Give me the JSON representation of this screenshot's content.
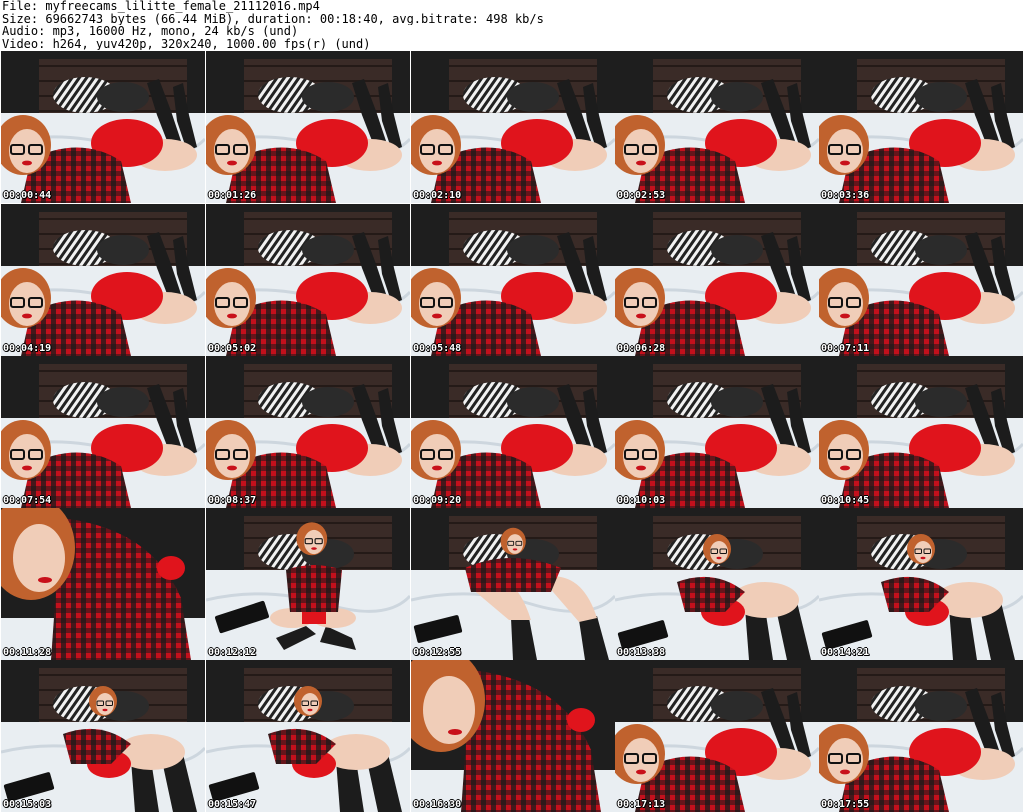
{
  "header": {
    "file": "File: myfreecams_lilitte_female_21112016.mp4",
    "size": "Size: 69662743 bytes (66.44 MiB), duration: 00:18:40, avg.bitrate: 498 kb/s",
    "audio": "Audio: mp3, 16000 Hz, mono, 24 kb/s (und)",
    "video": "Video: h264, yuv420p, 320x240, 1000.00 fps(r) (und)"
  },
  "colors": {
    "wall": "#1e1e1e",
    "headboard": "#3a2b27",
    "bed": "#e9eef2",
    "hair": "#c0622e",
    "plaid_red": "#c3101c",
    "plaid_black": "#1a1a1a",
    "shorts": "#e0141c",
    "skin": "#f0cdb8",
    "stockings": "#1c1c1c",
    "pillow_zebra": "#cfcfcf"
  },
  "thumbnails": [
    {
      "time": "00:00:44",
      "scene": "lying"
    },
    {
      "time": "00:01:26",
      "scene": "lying"
    },
    {
      "time": "00:02:10",
      "scene": "lying"
    },
    {
      "time": "00:02:53",
      "scene": "lying"
    },
    {
      "time": "00:03:36",
      "scene": "lying"
    },
    {
      "time": "00:04:19",
      "scene": "lying"
    },
    {
      "time": "00:05:02",
      "scene": "lying"
    },
    {
      "time": "00:05:48",
      "scene": "lying"
    },
    {
      "time": "00:06:28",
      "scene": "lying"
    },
    {
      "time": "00:07:11",
      "scene": "lying"
    },
    {
      "time": "00:07:54",
      "scene": "lying"
    },
    {
      "time": "00:08:37",
      "scene": "lying"
    },
    {
      "time": "00:09:20",
      "scene": "lying"
    },
    {
      "time": "00:10:03",
      "scene": "lying"
    },
    {
      "time": "00:10:45",
      "scene": "lying"
    },
    {
      "time": "00:11:28",
      "scene": "closeup"
    },
    {
      "time": "00:12:12",
      "scene": "sitting"
    },
    {
      "time": "00:12:55",
      "scene": "legs"
    },
    {
      "time": "00:13:38",
      "scene": "reclining"
    },
    {
      "time": "00:14:21",
      "scene": "reclining"
    },
    {
      "time": "00:15:03",
      "scene": "reclining"
    },
    {
      "time": "00:15:47",
      "scene": "reclining"
    },
    {
      "time": "00:16:30",
      "scene": "closeup"
    },
    {
      "time": "00:17:13",
      "scene": "lying"
    },
    {
      "time": "00:17:55",
      "scene": "lying"
    }
  ]
}
